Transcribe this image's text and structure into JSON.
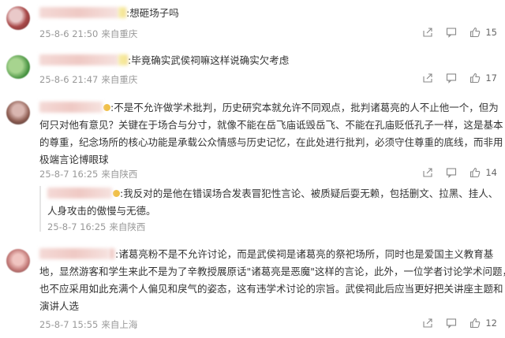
{
  "comments": [
    {
      "text_lines": [
        ":想砸场子吗"
      ],
      "time": "25-8-6 21:50",
      "location": "来自重庆",
      "likes": "15"
    },
    {
      "text_lines": [
        ":毕竟确实武侯祠嘛这样说确实欠考虑"
      ],
      "time": "25-8-6 21:47",
      "location": "来自重庆",
      "likes": "17"
    },
    {
      "text_lines": [
        ":不是不允许做学术批判，历史研究本就允许不同观点，批判诸葛亮的人不止他一个，但为",
        "何只对他有意见？关键在于场合与分寸，就像不能在岳飞庙诋毁岳飞、不能在孔庙贬低孔子一样，这是基本",
        "的尊重，纪念场所的核心功能是承载公众情感与历史记忆，在此处进行批判，必须守住尊重的底线，而非用",
        "极端言论博眼球"
      ],
      "time": "25-8-7 16:25",
      "location": "来自陕西",
      "likes": "14"
    },
    {
      "text_lines": [
        ":我反对的是他在错误场合发表冒犯性言论、被质疑后耍无赖，包括删文、拉黑、挂人、",
        "人身攻击的傲慢与无德。"
      ],
      "time": "25-8-7 16:25",
      "location": "来自陕西"
    },
    {
      "text_lines": [
        ":诸葛亮粉不是不允许讨论，而是武侯祠是诸葛亮的祭祀场所，同时也是爱国主义教育基",
        "地，显然游客和学生来此不是为了辛教授展原话\"诸葛亮是恶魔\"这样的言论，此外，一位学者讨论学术问题，",
        "也不应采用如此充满个人偏见和戾气的姿态，这有违学术讨论的宗旨。武侯祠此后应当更好把关讲座主题和",
        "演讲人选"
      ],
      "time": "25-8-7 15:55",
      "location": "来自上海",
      "likes": "12"
    }
  ],
  "icons": [
    "share-icon",
    "comment-icon",
    "like-icon"
  ]
}
